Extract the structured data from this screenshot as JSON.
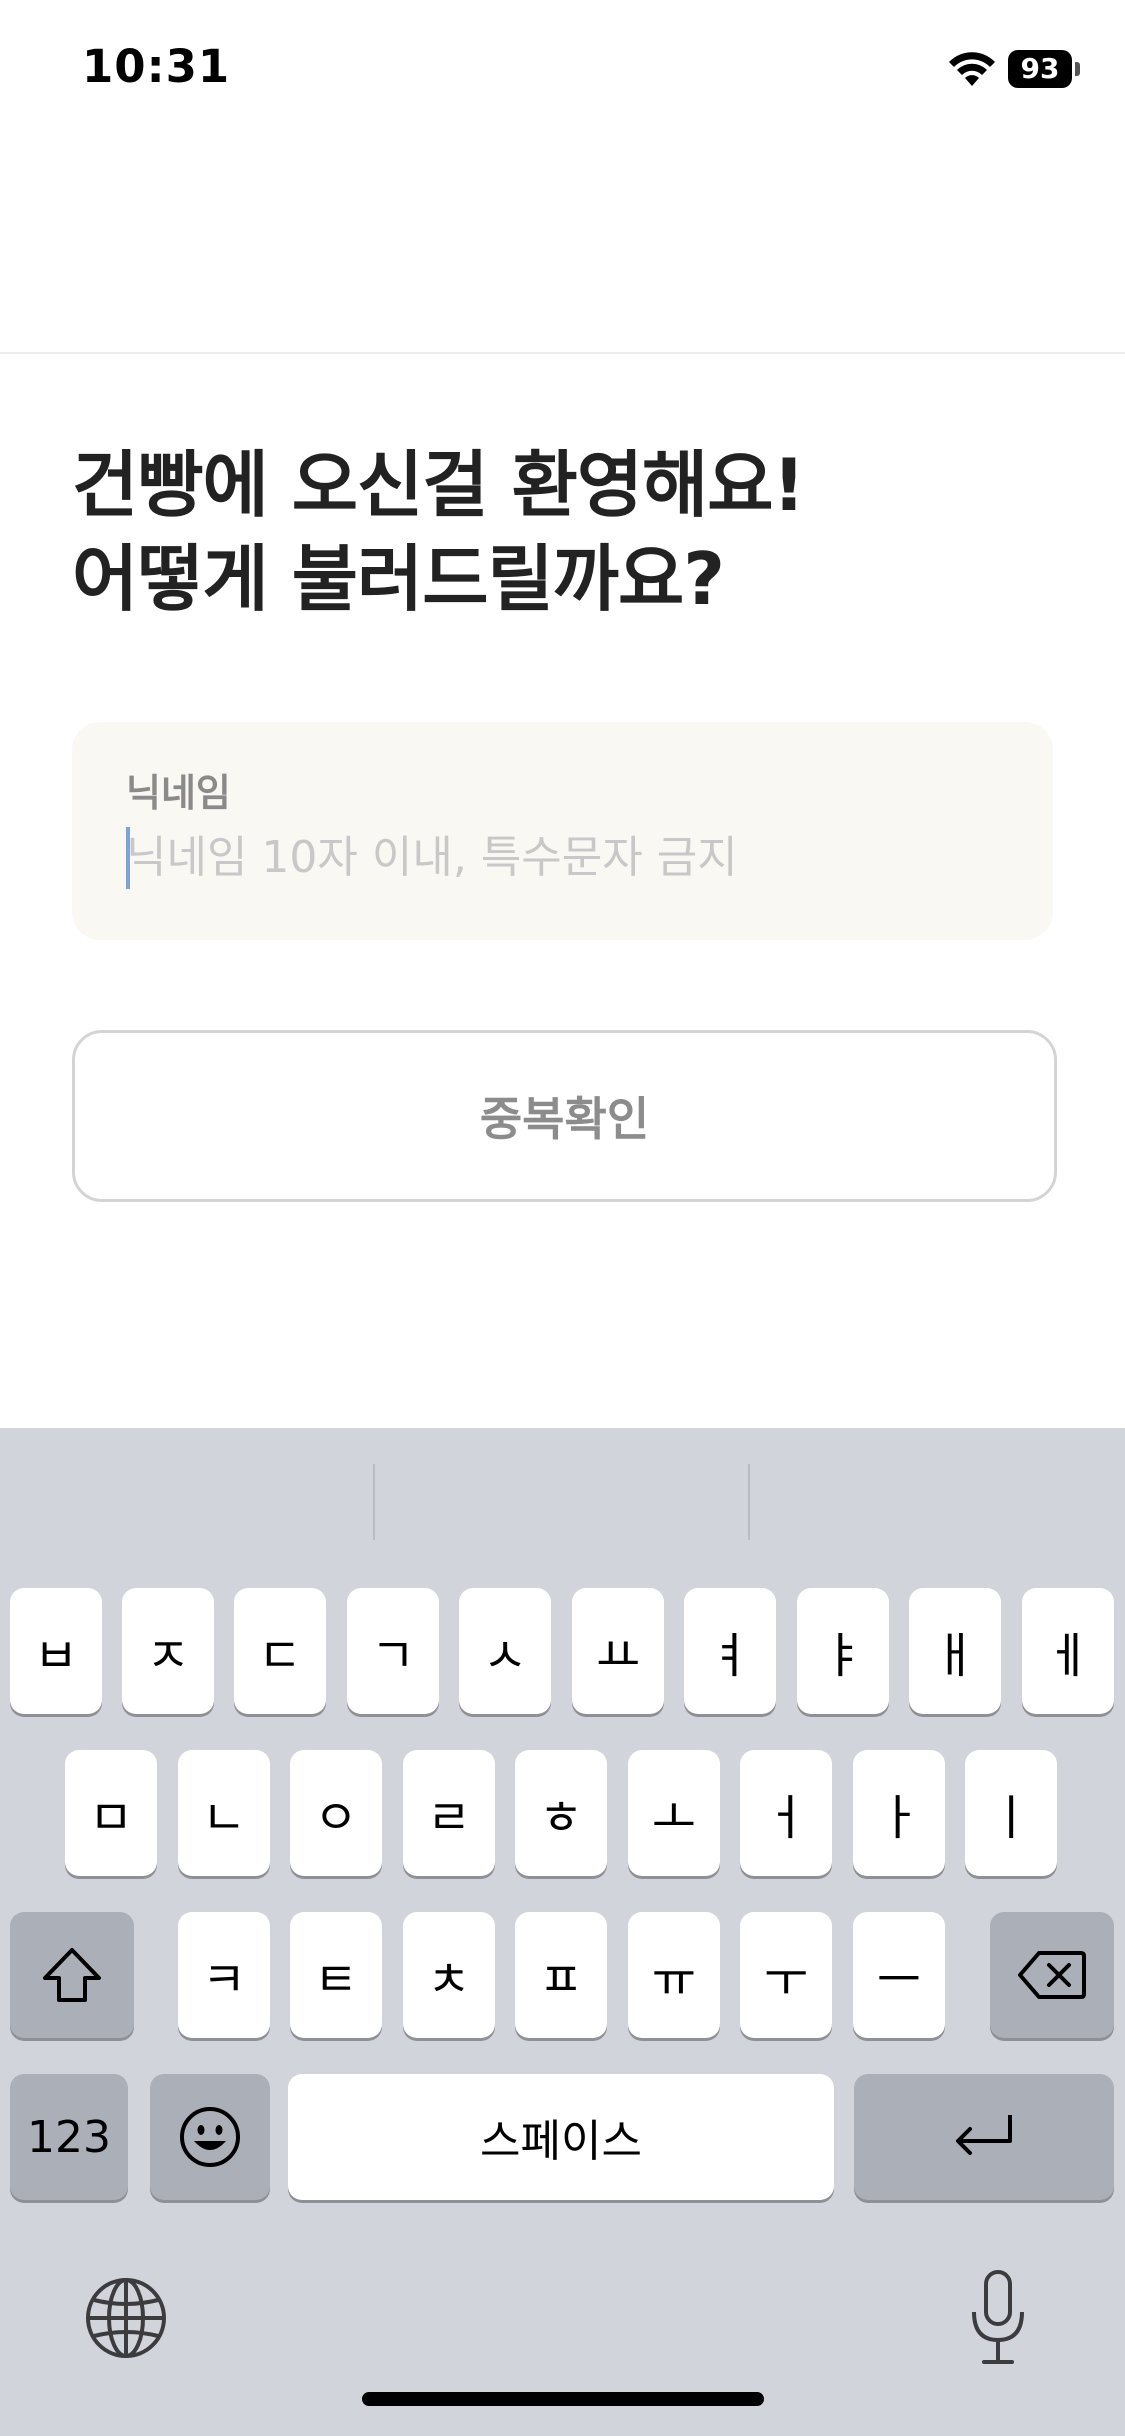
{
  "status_bar": {
    "time": "10:31",
    "battery": "93"
  },
  "heading": {
    "line1": "건빵에 오신걸 환영해요!",
    "line2": "어떻게 불러드릴까요?"
  },
  "nickname": {
    "label": "닉네임",
    "value": "",
    "placeholder": "닉네임 10자 이내, 특수문자 금지"
  },
  "check_button": {
    "label": "중복확인"
  },
  "keyboard": {
    "row1": [
      "ㅂ",
      "ㅈ",
      "ㄷ",
      "ㄱ",
      "ㅅ",
      "ㅛ",
      "ㅕ",
      "ㅑ",
      "ㅐ",
      "ㅔ"
    ],
    "row2": [
      "ㅁ",
      "ㄴ",
      "ㅇ",
      "ㄹ",
      "ㅎ",
      "ㅗ",
      "ㅓ",
      "ㅏ",
      "ㅣ"
    ],
    "row3": [
      "ㅋ",
      "ㅌ",
      "ㅊ",
      "ㅍ",
      "ㅠ",
      "ㅜ",
      "ㅡ"
    ],
    "numbers_label": "123",
    "space_label": "스페이스",
    "icons": {
      "shift": "shift-icon",
      "delete": "delete-icon",
      "emoji": "emoji-icon",
      "return": "return-icon",
      "globe": "globe-icon",
      "mic": "mic-icon"
    }
  }
}
